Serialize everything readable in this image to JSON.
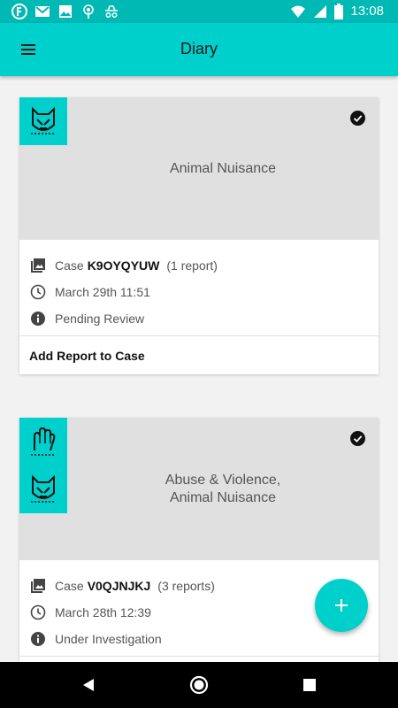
{
  "status_bar": {
    "time": "13:08",
    "left_icons": [
      "firefox-icon",
      "gmail-icon",
      "image-icon",
      "podcast-icon",
      "incognito-icon"
    ],
    "right_icons": [
      "wifi-icon",
      "signal-icon",
      "battery-icon"
    ]
  },
  "app_bar": {
    "title": "Diary",
    "menu_icon": "hamburger-menu-icon"
  },
  "cards": [
    {
      "category_icons": [
        "animal-nuisance-icon"
      ],
      "category_line1": "Animal Nuisance",
      "category_line2": "",
      "selected": true,
      "case_prefix": "Case",
      "case_id": "K9OYQYUW",
      "report_count": "(1 report)",
      "date": "March 29th 11:51",
      "status": "Pending Review",
      "action_label": "Add Report to Case"
    },
    {
      "category_icons": [
        "abuse-violence-icon",
        "animal-nuisance-icon"
      ],
      "category_line1": "Abuse & Violence,",
      "category_line2": "Animal Nuisance",
      "selected": true,
      "case_prefix": "Case",
      "case_id": "V0QJNJKJ",
      "report_count": "(3 reports)",
      "date": "March 28th 12:39",
      "status": "Under Investigation",
      "action_label": ""
    }
  ],
  "fab": {
    "label": "+",
    "icon": "add-icon"
  },
  "colors": {
    "accent": "#00d0cb",
    "status_bar": "#00b8b4",
    "media_bg": "#e0e0e0"
  }
}
